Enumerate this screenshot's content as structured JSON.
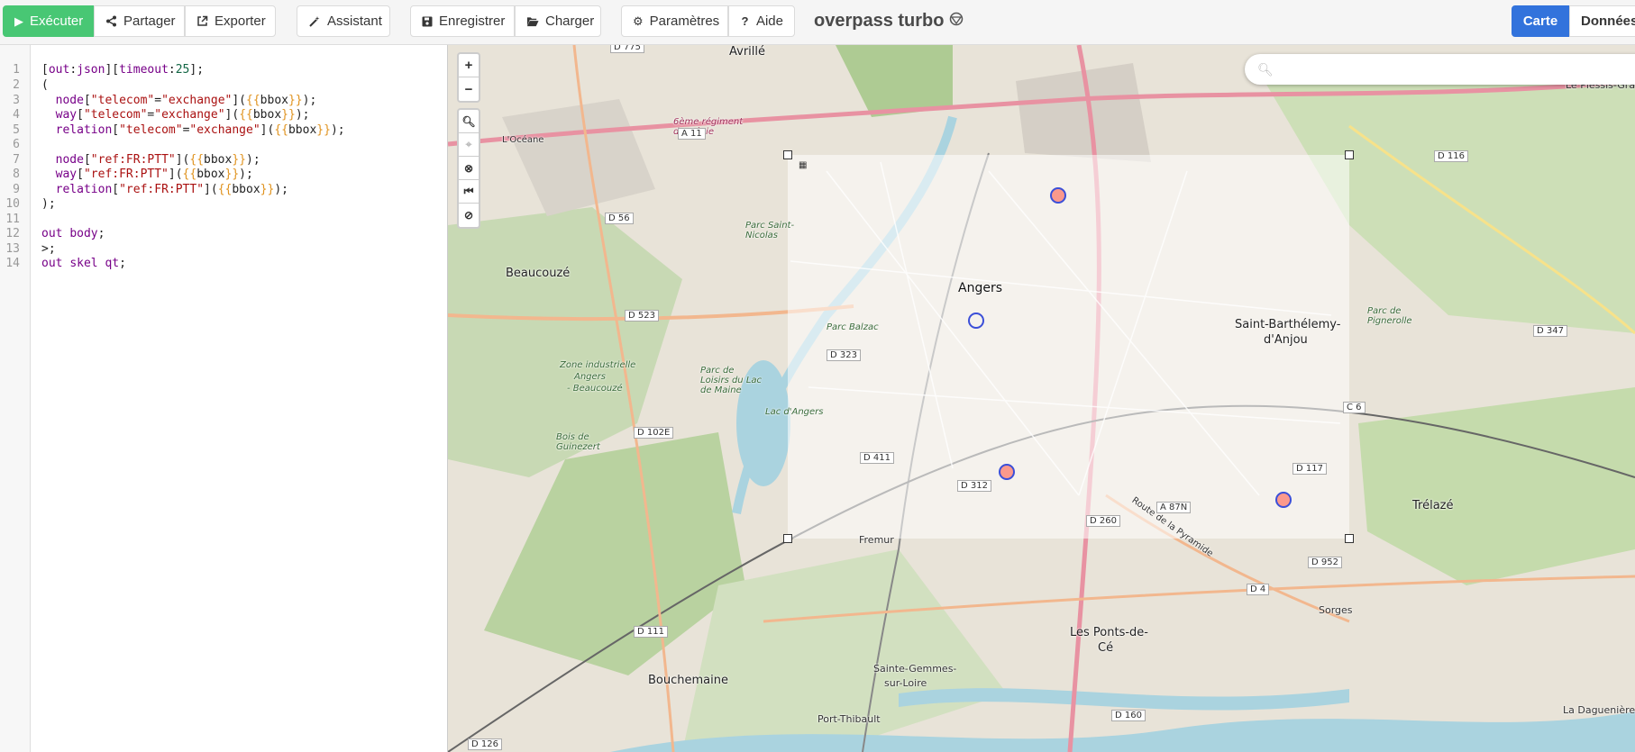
{
  "toolbar": {
    "run": "Exécuter",
    "share": "Partager",
    "export": "Exporter",
    "wizard": "Assistant",
    "save": "Enregistrer",
    "load": "Charger",
    "settings": "Paramètres",
    "help": "Aide",
    "title": "overpass turbo",
    "tab_map": "Carte",
    "tab_data": "Données"
  },
  "editor": {
    "line_numbers": [
      "1",
      "2",
      "3",
      "4",
      "5",
      "6",
      "7",
      "8",
      "9",
      "10",
      "11",
      "12",
      "13",
      "14"
    ]
  },
  "map": {
    "search_placeholder": "",
    "labels": {
      "angers": "Angers",
      "saint_barth": "Saint-Barthélemy-",
      "saint_barth2": "d'Anjou",
      "beaucouze": "Beaucouzé",
      "avrille": "Avrillé",
      "trelaze": "Trélazé",
      "ponts_de_ce": "Les Ponts-de-",
      "ponts_de_ce2": "Cé",
      "bouchemaine": "Bouchemaine",
      "sainte_gemmes": "Sainte-Gemmes-",
      "sainte_gemmes2": "sur-Loire",
      "port_thibault": "Port-Thibault",
      "sorges": "Sorges",
      "fremur": "Fremur",
      "daguenière": "La Daguenière",
      "plessis": "Le Plessis-Grammoire",
      "zone_ind1": "Zone industrielle",
      "zone_ind2": "Angers",
      "zone_ind3": "- Beaucouzé",
      "parc_balzac": "Parc Balzac",
      "lac_maine": "Lac d'Angers",
      "parc_loisirs": "Parc de Loisirs du Lac de Maine",
      "bois_guinezert": "Bois de Guinezert",
      "regiment": "6ème régiment du Génie",
      "parc_pignerolle": "Parc de Pignerolle",
      "parc_saint_nicolas": "Parc Saint-Nicolas",
      "route_pyramide": "Route de la Pyramide",
      "oceane": "L'Océane"
    },
    "roads": [
      "D 775",
      "A 11",
      "D 56",
      "D 523",
      "D 323",
      "D 102E",
      "D 411",
      "D 312",
      "D 260",
      "A 87N",
      "D 117",
      "D 952",
      "D 4",
      "D 111",
      "D 160",
      "D 126",
      "D 116",
      "D 347",
      "C 6"
    ]
  },
  "colors": {
    "run_green": "#48c774",
    "tab_blue": "#3273dc",
    "marker_blue": "#3b4fd8"
  }
}
